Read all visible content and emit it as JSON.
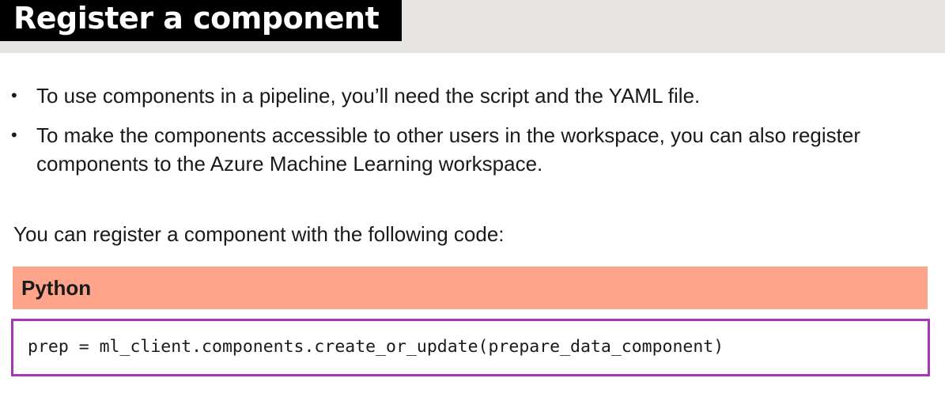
{
  "header": {
    "title": "Register a component"
  },
  "bullets": [
    "To use components in a pipeline, you’ll need the script and the YAML file.",
    "To make the components accessible to other users in the workspace, you can also register components to the Azure Machine Learning workspace."
  ],
  "bullet_symbol": "•",
  "intro_text": "You can register a component with the following code:",
  "code_block": {
    "language": "Python",
    "code": "prep = ml_client.components.create_or_update(prepare_data_component)"
  },
  "colors": {
    "title_bg": "#000000",
    "title_band": "#e6e5e1",
    "code_header_bg": "#fea48a",
    "code_border": "#a836b8"
  }
}
